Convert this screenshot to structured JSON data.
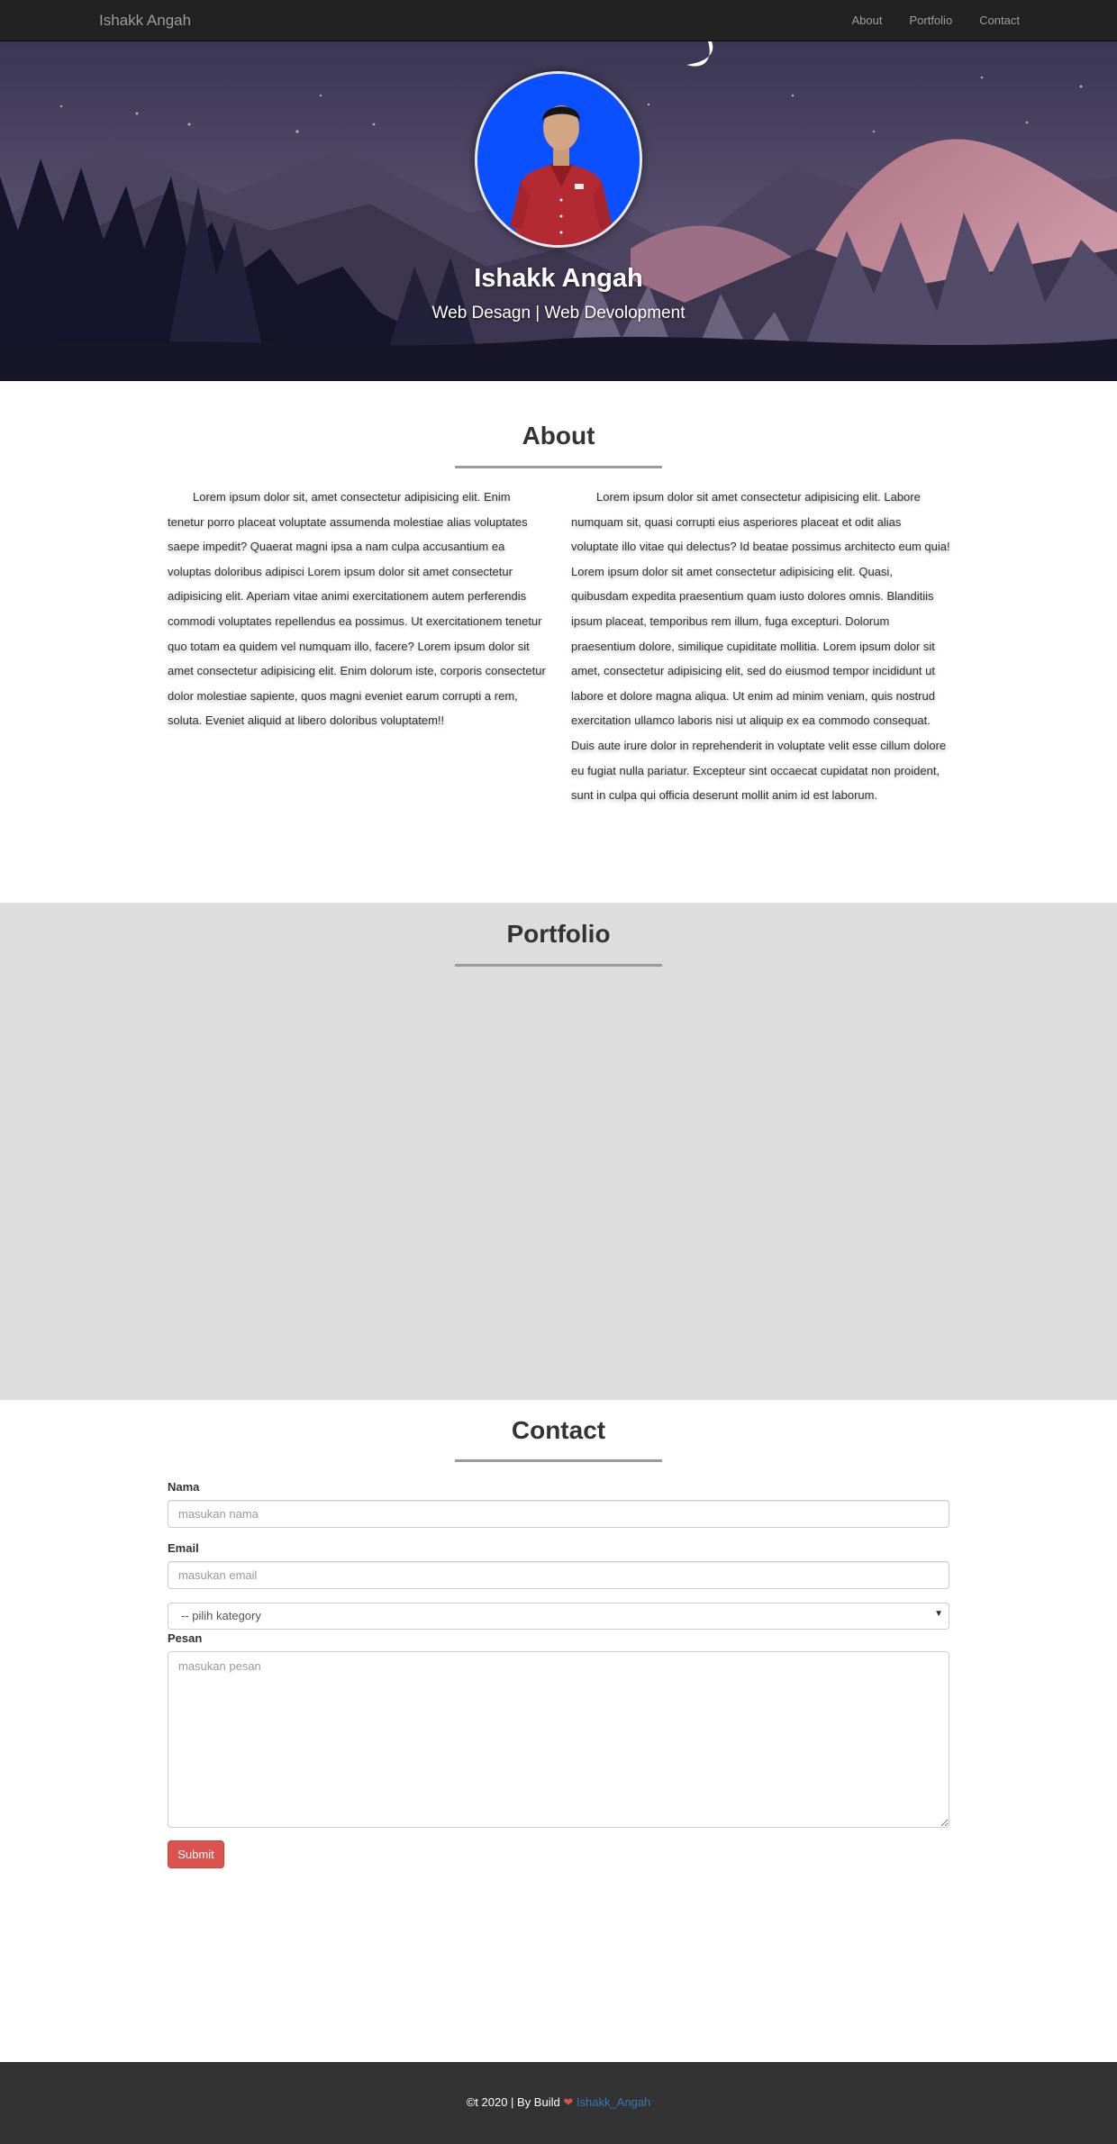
{
  "navbar": {
    "brand": "Ishakk Angah",
    "links": [
      "About",
      "Portfolio",
      "Contact"
    ]
  },
  "hero": {
    "name": "Ishakk Angah",
    "subtitle": "Web Desagn | Web Devolopment"
  },
  "about": {
    "title": "About",
    "left_text": "Lorem ipsum dolor sit, amet consectetur adipisicing elit. Enim tenetur porro placeat voluptate assumenda molestiae alias voluptates saepe impedit? Quaerat magni ipsa a nam culpa accusantium ea voluptas doloribus adipisci Lorem ipsum dolor sit amet consectetur adipisicing elit. Aperiam vitae animi exercitationem autem perferendis commodi voluptates repellendus ea possimus. Ut exercitationem tenetur quo totam ea quidem vel numquam illo, facere? Lorem ipsum dolor sit amet consectetur adipisicing elit. Enim dolorum iste, corporis consectetur dolor molestiae sapiente, quos magni eveniet earum corrupti a rem, soluta. Eveniet aliquid at libero doloribus voluptatem!!",
    "right_text": "Lorem ipsum dolor sit amet consectetur adipisicing elit. Labore numquam sit, quasi corrupti eius asperiores placeat et odit alias voluptate illo vitae qui delectus? Id beatae possimus architecto eum quia! Lorem ipsum dolor sit amet consectetur adipisicing elit. Quasi, quibusdam expedita praesentium quam iusto dolores omnis. Blanditiis ipsum placeat, temporibus rem illum, fuga excepturi. Dolorum praesentium dolore, similique cupiditate mollitia. Lorem ipsum dolor sit amet, consectetur adipisicing elit, sed do eiusmod tempor incididunt ut labore et dolore magna aliqua. Ut enim ad minim veniam, quis nostrud exercitation ullamco laboris nisi ut aliquip ex ea commodo consequat. Duis aute irure dolor in reprehenderit in voluptate velit esse cillum dolore eu fugiat nulla pariatur. Excepteur sint occaecat cupidatat non proident, sunt in culpa qui officia deserunt mollit anim id est laborum."
  },
  "portfolio": {
    "title": "Portfolio"
  },
  "contact": {
    "title": "Contact",
    "name_label": "Nama",
    "name_placeholder": "masukan nama",
    "email_label": "Email",
    "email_placeholder": "masukan email",
    "category_selected": "-- pilih kategory",
    "message_label": "Pesan",
    "message_placeholder": "masukan pesan",
    "submit_label": "Submit"
  },
  "footer": {
    "copyright": "©t 2020 | By Build",
    "heart_icon": "heart-icon",
    "author_link": "Ishakk_Angah"
  },
  "colors": {
    "navbar": "#222222",
    "portfolio_bg": "#dddddd",
    "submit": "#d9534f",
    "footer": "#333333",
    "link": "#337ab7"
  }
}
